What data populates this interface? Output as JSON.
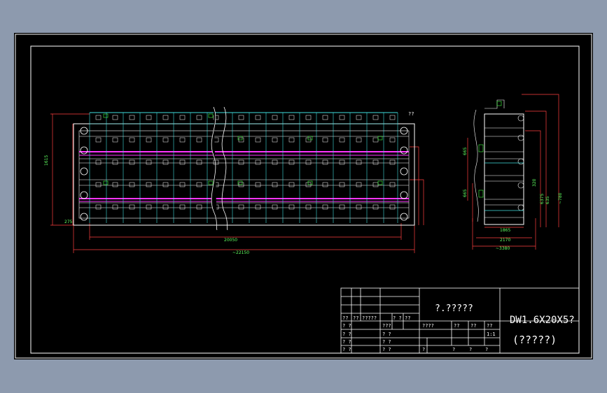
{
  "drawing": {
    "code": "DW1.6X20X5?",
    "name": "(?????)",
    "title_center": "?.?????",
    "marker": "??"
  },
  "dimensions": {
    "front_height": "1615",
    "front_inner_width": "20050",
    "front_overall_width": "~22150",
    "left_small": "275",
    "side_width_inner": "1865",
    "side_width_mid": "2170",
    "side_width_overall": "~3380",
    "side_h1": "635",
    "side_h2": "6375",
    "side_h3": "~780",
    "side_left_a": "665",
    "side_left_b": "665",
    "side_right_small": "320"
  },
  "title_block": {
    "r1": [
      "?? ??",
      "?????",
      "? ?",
      "??"
    ],
    "r2": [
      "? ?",
      "? ?"
    ],
    "r3": [
      "? ?",
      "? ?"
    ],
    "r4": [
      "? ?",
      "? ?"
    ],
    "mid_row": [
      "????",
      "??",
      "??",
      "??"
    ],
    "mid_row2": [
      "1:1"
    ],
    "bottom_row": [
      "?",
      "?",
      "?",
      "?"
    ],
    "left_header": [
      "??",
      "??",
      "?????",
      "? ?",
      "??"
    ],
    "left_r2": [
      "? ?",
      "???"
    ],
    "left_r3": [
      "? ?",
      "? ?"
    ],
    "left_r4": [
      "? ?",
      "? ?"
    ]
  },
  "colors": {
    "background": "#000000",
    "frame": "#ffffff",
    "dimension": "#ff4040",
    "dimension_text": "#40ff40",
    "conveyor": "#ff33ff",
    "structure": "#40e0e0"
  }
}
